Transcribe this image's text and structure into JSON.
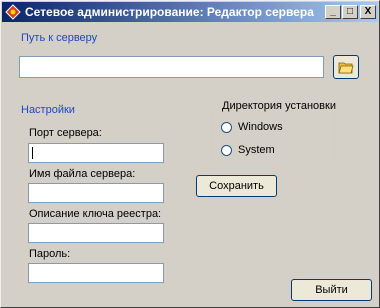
{
  "window": {
    "title": "Сетевое администрирование: Редактор сервера",
    "minimize_glyph": "_",
    "maximize_glyph": "□",
    "close_glyph": "X"
  },
  "server_path": {
    "label": "Путь к серверу",
    "value": ""
  },
  "settings": {
    "section_label": "Настройки",
    "port_label": "Порт сервера:",
    "port_value": "",
    "filename_label": "Имя файла сервера:",
    "filename_value": "",
    "registry_label": "Описание ключа реестра:",
    "registry_value": "",
    "password_label": "Пароль:",
    "password_value": ""
  },
  "install_dir": {
    "title": "Директория установки",
    "options": [
      "Windows",
      "System"
    ]
  },
  "buttons": {
    "save": "Сохранить",
    "exit": "Выйти"
  },
  "icons": {
    "app": "app-icon",
    "browse": "folder-open-icon"
  }
}
